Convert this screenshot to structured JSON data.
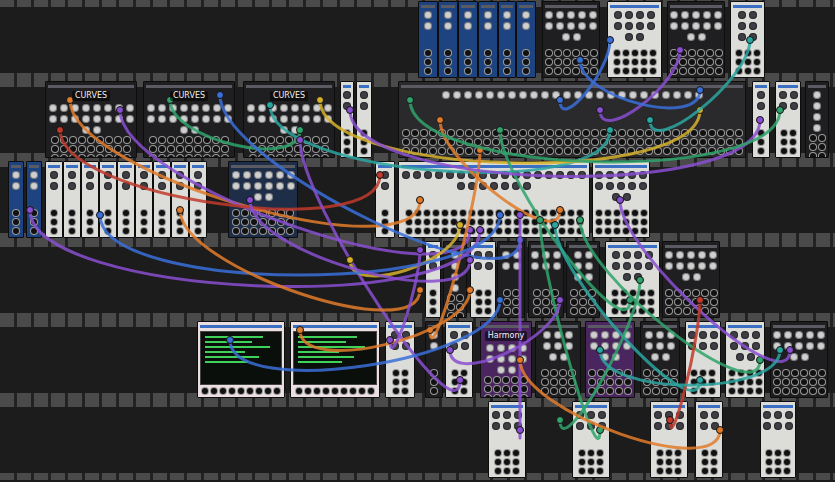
{
  "rack": {
    "rows": [
      {
        "modules": [
          {
            "kind": "blue"
          },
          {
            "kind": "blue"
          },
          {
            "kind": "blue"
          },
          {
            "kind": "blue"
          },
          {
            "kind": "blue"
          },
          {
            "kind": "blue"
          },
          {
            "kind": "dark"
          },
          {
            "kind": "light"
          },
          {
            "kind": "dark"
          },
          {
            "kind": "light"
          }
        ]
      },
      {
        "modules": [
          {
            "kind": "dark",
            "label": "CURVES"
          },
          {
            "kind": "dark",
            "label": "CURVES"
          },
          {
            "kind": "dark",
            "label": "CURVES"
          },
          {
            "kind": "light"
          },
          {
            "kind": "light"
          },
          {
            "kind": "mixer"
          },
          {
            "kind": "light"
          },
          {
            "kind": "light"
          },
          {
            "kind": "dark"
          }
        ]
      },
      {
        "modules": [
          {
            "kind": "blue"
          },
          {
            "kind": "blue"
          },
          {
            "kind": "light"
          },
          {
            "kind": "light"
          },
          {
            "kind": "light"
          },
          {
            "kind": "light"
          },
          {
            "kind": "light"
          },
          {
            "kind": "light"
          },
          {
            "kind": "light"
          },
          {
            "kind": "light"
          },
          {
            "kind": "light"
          },
          {
            "kind": "navy"
          },
          {
            "kind": "light"
          },
          {
            "kind": "light"
          },
          {
            "kind": "light"
          }
        ]
      },
      {
        "modules": [
          {
            "kind": "light"
          },
          {
            "kind": "dark"
          },
          {
            "kind": "light"
          },
          {
            "kind": "dark"
          },
          {
            "kind": "dark"
          },
          {
            "kind": "dark"
          },
          {
            "kind": "light"
          },
          {
            "kind": "dark"
          }
        ]
      },
      {
        "modules": [
          {
            "kind": "screen"
          },
          {
            "kind": "screen"
          },
          {
            "kind": "light"
          },
          {
            "kind": "dark"
          },
          {
            "kind": "light"
          },
          {
            "kind": "purple",
            "label": "Harmony"
          },
          {
            "kind": "dark"
          },
          {
            "kind": "purple"
          },
          {
            "kind": "dark"
          },
          {
            "kind": "light"
          },
          {
            "kind": "light"
          },
          {
            "kind": "dark"
          }
        ]
      },
      {
        "modules": [
          {
            "kind": "light"
          },
          {
            "kind": "light"
          },
          {
            "kind": "light"
          },
          {
            "kind": "light"
          },
          {
            "kind": "light"
          }
        ]
      }
    ]
  },
  "cables": [
    {
      "color": "#e07b2a"
    },
    {
      "color": "#8a4fd0"
    },
    {
      "color": "#2fa36b"
    },
    {
      "color": "#3a6fd8"
    },
    {
      "color": "#2aa6a0"
    },
    {
      "color": "#d6b02a"
    },
    {
      "color": "#c0392b"
    },
    {
      "color": "#8a4fd0"
    },
    {
      "color": "#e07b2a"
    },
    {
      "color": "#2fa36b"
    },
    {
      "color": "#3a6fd8"
    },
    {
      "color": "#8a4fd0"
    },
    {
      "color": "#2aa6a0"
    },
    {
      "color": "#e07b2a"
    },
    {
      "color": "#8a4fd0"
    },
    {
      "color": "#2fa36b"
    },
    {
      "color": "#d6b02a"
    },
    {
      "color": "#8a4fd0"
    },
    {
      "color": "#3a6fd8"
    },
    {
      "color": "#e07b2a"
    },
    {
      "color": "#8a4fd0"
    },
    {
      "color": "#2aa6a0"
    },
    {
      "color": "#2fa36b"
    },
    {
      "color": "#8a4fd0"
    },
    {
      "color": "#e07b2a"
    },
    {
      "color": "#3a6fd8"
    },
    {
      "color": "#8a4fd0"
    },
    {
      "color": "#2fa36b"
    },
    {
      "color": "#c0392b"
    },
    {
      "color": "#8a4fd0"
    },
    {
      "color": "#2aa6a0"
    },
    {
      "color": "#e07b2a"
    },
    {
      "color": "#8a4fd0"
    },
    {
      "color": "#2fa36b"
    },
    {
      "color": "#3a6fd8"
    }
  ]
}
